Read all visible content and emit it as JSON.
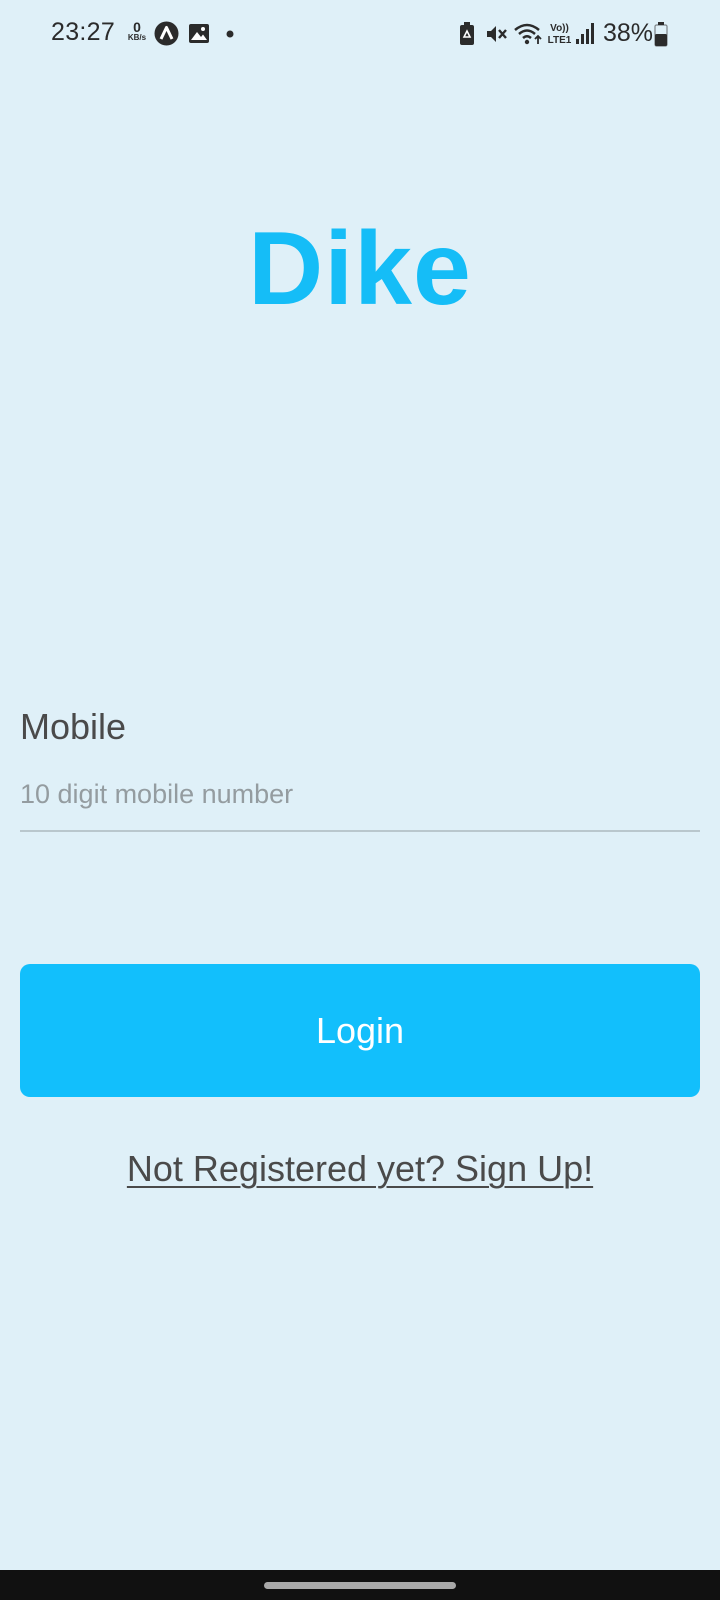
{
  "status_bar": {
    "time": "23:27",
    "net_speed_value": "0",
    "net_speed_unit": "KB/s",
    "battery_percent": "38%",
    "icons": [
      "data-speed-indicator",
      "app-notification-icon",
      "image-notification-icon",
      "more-dot-icon",
      "battery-saver-icon",
      "mute-icon",
      "wifi-icon",
      "volte-icon",
      "signal-icon",
      "battery-icon"
    ],
    "network_label": "Vo)) LTE1"
  },
  "app": {
    "logo": "Dike",
    "accent_color": "#15bdf7"
  },
  "form": {
    "mobile_label": "Mobile",
    "mobile_placeholder": "10 digit mobile number",
    "mobile_value": "",
    "login_label": "Login",
    "signup_link": "Not Registered yet? Sign Up!"
  }
}
